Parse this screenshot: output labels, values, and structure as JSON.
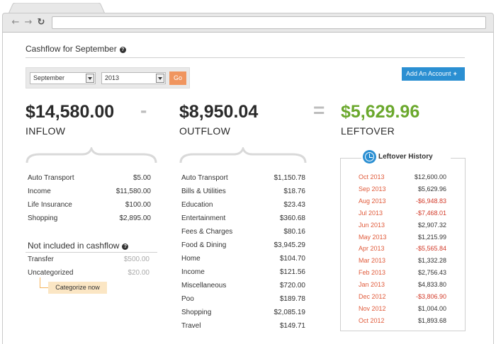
{
  "page": {
    "title": "Cashflow for September",
    "help_glyph": "?"
  },
  "filters": {
    "month": "September",
    "year": "2013",
    "go_label": "Go"
  },
  "add_account": {
    "label": "Add An Account",
    "plus": "+"
  },
  "summary": {
    "inflow_amount": "$14,580.00",
    "inflow_label": "INFLOW",
    "minus": "-",
    "outflow_amount": "$8,950.04",
    "outflow_label": "OUTFLOW",
    "equals": "=",
    "leftover_amount": "$5,629.96",
    "leftover_label": "LEFTOVER"
  },
  "inflow_items": [
    {
      "name": "Auto Transport",
      "amount": "$5.00"
    },
    {
      "name": "Income",
      "amount": "$11,580.00"
    },
    {
      "name": "Life Insurance",
      "amount": "$100.00"
    },
    {
      "name": "Shopping",
      "amount": "$2,895.00"
    }
  ],
  "not_included": {
    "title": "Not included in cashflow",
    "items": [
      {
        "name": "Transfer",
        "amount": "$500.00"
      },
      {
        "name": "Uncategorized",
        "amount": "$20.00"
      }
    ],
    "categorize_label": "Categorize now"
  },
  "outflow_items": [
    {
      "name": "Auto Transport",
      "amount": "$1,150.78"
    },
    {
      "name": "Bills & Utilities",
      "amount": "$18.76"
    },
    {
      "name": "Education",
      "amount": "$23.43"
    },
    {
      "name": "Entertainment",
      "amount": "$360.68"
    },
    {
      "name": "Fees & Charges",
      "amount": "$80.16"
    },
    {
      "name": "Food & Dining",
      "amount": "$3,945.29"
    },
    {
      "name": "Home",
      "amount": "$104.70"
    },
    {
      "name": "Income",
      "amount": "$121.56"
    },
    {
      "name": "Miscellaneous",
      "amount": "$720.00"
    },
    {
      "name": "Poo",
      "amount": "$189.78"
    },
    {
      "name": "Shopping",
      "amount": "$2,085.19"
    },
    {
      "name": "Travel",
      "amount": "$149.71"
    }
  ],
  "history": {
    "title": "Leftover History",
    "rows": [
      {
        "month": "Oct 2013",
        "value": "$12,600.00",
        "negative": false
      },
      {
        "month": "Sep 2013",
        "value": "$5,629.96",
        "negative": false
      },
      {
        "month": "Aug 2013",
        "value": "-$6,948.83",
        "negative": true
      },
      {
        "month": "Jul 2013",
        "value": "-$7,468.01",
        "negative": true
      },
      {
        "month": "Jun 2013",
        "value": "$2,907.32",
        "negative": false
      },
      {
        "month": "May 2013",
        "value": "$1,215.99",
        "negative": false
      },
      {
        "month": "Apr 2013",
        "value": "-$5,565.84",
        "negative": true
      },
      {
        "month": "Mar 2013",
        "value": "$1,332.28",
        "negative": false
      },
      {
        "month": "Feb 2013",
        "value": "$2,756.43",
        "negative": false
      },
      {
        "month": "Jan 2013",
        "value": "$4,833.80",
        "negative": false
      },
      {
        "month": "Dec 2012",
        "value": "-$3,806.90",
        "negative": true
      },
      {
        "month": "Nov 2012",
        "value": "$1,004.00",
        "negative": false
      },
      {
        "month": "Oct 2012",
        "value": "$1,893.68",
        "negative": false
      }
    ]
  },
  "colors": {
    "accent_blue": "#2b8fd2",
    "go_orange": "#f0955f",
    "leftover_green": "#6ba82d",
    "negative_red": "#d23b2a",
    "month_red": "#e05a3a"
  }
}
